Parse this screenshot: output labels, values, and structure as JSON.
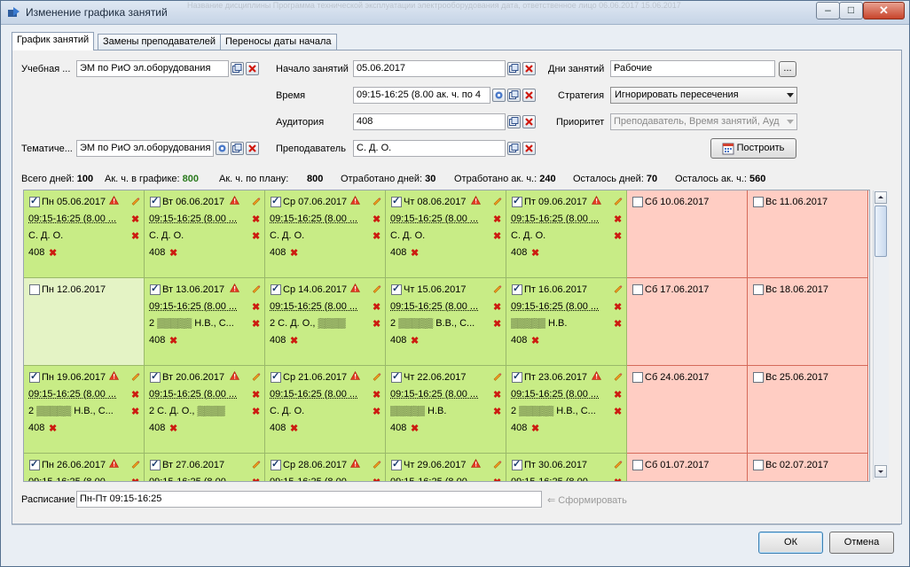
{
  "window": {
    "title": "Изменение графика занятий",
    "ghost_text": "Название дисциплины   Программа технической эксплуатации электрооборудования   дата, ответственное лицо   06.06.2017   15.06.2017"
  },
  "tabs": [
    {
      "label": "График занятий"
    },
    {
      "label": "Замены преподавателей"
    },
    {
      "label": "Переносы даты начала"
    }
  ],
  "form": {
    "uchebnaya_label": "Учебная ...",
    "uchebnaya_value": "ЭМ по РиО эл.оборудования",
    "tematich_label": "Тематиче...",
    "tematich_value": "ЭМ по РиО эл.оборудования",
    "nachalo_label": "Начало занятий",
    "nachalo_value": "05.06.2017",
    "vremya_label": "Время",
    "vremya_value": "09:15-16:25  (8.00 ак. ч. по 4",
    "auditoriya_label": "Аудитория",
    "auditoriya_value": "408",
    "prepod_label": "Преподаватель",
    "prepod_value": "С. Д. О.",
    "dni_label": "Дни занятий",
    "dni_value": "Рабочие",
    "dni_btn": "...",
    "strategiya_label": "Стратегия",
    "strategiya_value": "Игнорировать пересечения",
    "prioritet_label": "Приоритет",
    "prioritet_value": "Преподаватель, Время занятий, Ауд",
    "build_label": "Построить"
  },
  "stats": {
    "total_days_label": "Всего дней:",
    "total_days": "100",
    "in_schedule_label": "Ак. ч. в графике:",
    "in_schedule": "800",
    "by_plan_label": "Ак. ч. по плану:",
    "by_plan": "800",
    "worked_days_label": "Отработано дней:",
    "worked_days": "30",
    "worked_hours_label": "Отработано ак. ч.:",
    "worked_hours": "240",
    "left_days_label": "Осталось дней:",
    "left_days": "70",
    "left_hours_label": "Осталось ак. ч.:",
    "left_hours": "560"
  },
  "calendar": {
    "time_text": "09:15-16:25  (8.00 ...",
    "room": "408",
    "colors": {
      "work": "#c8ec86",
      "off": "#e4f3c5",
      "weekend": "#ffcdc3"
    },
    "weeks": [
      [
        {
          "date": "Пн 05.06.2017",
          "checked": true,
          "kind": "work",
          "warn": true,
          "teacher": "С. Д. О."
        },
        {
          "date": "Вт 06.06.2017",
          "checked": true,
          "kind": "work",
          "warn": true,
          "teacher": "С. Д. О."
        },
        {
          "date": "Ср 07.06.2017",
          "checked": true,
          "kind": "work",
          "warn": true,
          "teacher": "С. Д. О."
        },
        {
          "date": "Чт 08.06.2017",
          "checked": true,
          "kind": "work",
          "warn": true,
          "teacher": "С. Д. О."
        },
        {
          "date": "Пт 09.06.2017",
          "checked": true,
          "kind": "work",
          "warn": true,
          "teacher": "С. Д. О."
        },
        {
          "date": "Сб 10.06.2017",
          "checked": false,
          "kind": "wknd"
        },
        {
          "date": "Вс 11.06.2017",
          "checked": false,
          "kind": "wknd"
        }
      ],
      [
        {
          "date": "Пн 12.06.2017",
          "checked": false,
          "kind": "off"
        },
        {
          "date": "Вт 13.06.2017",
          "checked": true,
          "kind": "work",
          "warn": true,
          "teacher": "2 ▒▒▒▒▒ Н.В., С..."
        },
        {
          "date": "Ср 14.06.2017",
          "checked": true,
          "kind": "work",
          "warn": true,
          "teacher": "2 С. Д. О., ▒▒▒▒"
        },
        {
          "date": "Чт 15.06.2017",
          "checked": true,
          "kind": "work",
          "warn": false,
          "teacher": "2 ▒▒▒▒▒ В.В., С..."
        },
        {
          "date": "Пт 16.06.2017",
          "checked": true,
          "kind": "work",
          "warn": false,
          "teacher": "▒▒▒▒▒ Н.В."
        },
        {
          "date": "Сб 17.06.2017",
          "checked": false,
          "kind": "wknd"
        },
        {
          "date": "Вс 18.06.2017",
          "checked": false,
          "kind": "wknd"
        }
      ],
      [
        {
          "date": "Пн 19.06.2017",
          "checked": true,
          "kind": "work",
          "warn": true,
          "teacher": "2 ▒▒▒▒▒ Н.В., С..."
        },
        {
          "date": "Вт 20.06.2017",
          "checked": true,
          "kind": "work",
          "warn": true,
          "teacher": "2 С. Д. О., ▒▒▒▒"
        },
        {
          "date": "Ср 21.06.2017",
          "checked": true,
          "kind": "work",
          "warn": true,
          "teacher": "С. Д. О."
        },
        {
          "date": "Чт 22.06.2017",
          "checked": true,
          "kind": "work",
          "warn": false,
          "teacher": "▒▒▒▒▒ Н.В."
        },
        {
          "date": "Пт 23.06.2017",
          "checked": true,
          "kind": "work",
          "warn": true,
          "teacher": "2 ▒▒▒▒▒ Н.В., С..."
        },
        {
          "date": "Сб 24.06.2017",
          "checked": false,
          "kind": "wknd"
        },
        {
          "date": "Вс 25.06.2017",
          "checked": false,
          "kind": "wknd"
        }
      ],
      [
        {
          "date": "Пн 26.06.2017",
          "checked": true,
          "kind": "work",
          "warn": true,
          "teacher": ""
        },
        {
          "date": "Вт 27.06.2017",
          "checked": true,
          "kind": "work",
          "warn": false,
          "teacher": ""
        },
        {
          "date": "Ср 28.06.2017",
          "checked": true,
          "kind": "work",
          "warn": true,
          "teacher": ""
        },
        {
          "date": "Чт 29.06.2017",
          "checked": true,
          "kind": "work",
          "warn": true,
          "teacher": ""
        },
        {
          "date": "Пт 30.06.2017",
          "checked": true,
          "kind": "work",
          "warn": false,
          "teacher": ""
        },
        {
          "date": "Сб 01.07.2017",
          "checked": false,
          "kind": "wknd"
        },
        {
          "date": "Вс 02.07.2017",
          "checked": false,
          "kind": "wknd"
        }
      ]
    ]
  },
  "schedule": {
    "label": "Расписание",
    "value": "Пн-Пт 09:15-16:25",
    "generate": "⇐ Сформировать"
  },
  "buttons": {
    "ok": "ОК",
    "cancel": "Отмена"
  }
}
